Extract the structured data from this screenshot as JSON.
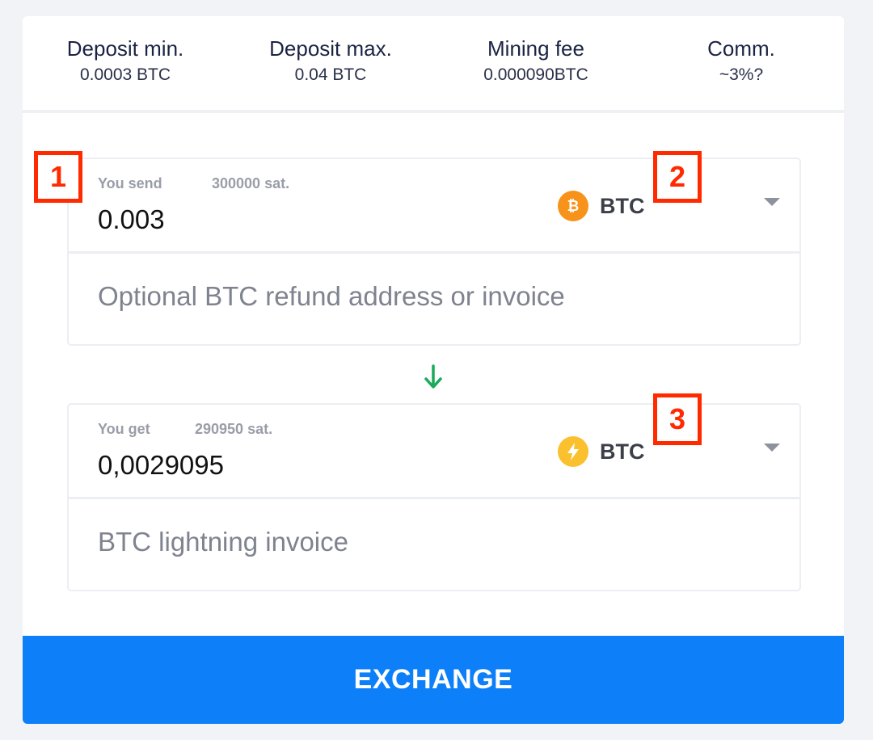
{
  "limits": [
    {
      "title": "Deposit min.",
      "value": "0.0003 BTC"
    },
    {
      "title": "Deposit max.",
      "value": "0.04 BTC"
    },
    {
      "title": "Mining fee",
      "value": "0.000090BTC"
    },
    {
      "title": "Comm.",
      "value": "~3%?"
    }
  ],
  "send": {
    "label": "You send",
    "sats": "300000 sat.",
    "amount": "0.003",
    "currency": "BTC",
    "icon": "bitcoin-icon",
    "refund_placeholder": "Optional BTC refund address or invoice"
  },
  "get": {
    "label": "You get",
    "sats": "290950 sat.",
    "amount": "0,0029095",
    "currency": "BTC",
    "icon": "lightning-icon",
    "invoice_placeholder": "BTC lightning invoice"
  },
  "markers": [
    "1",
    "2",
    "3"
  ],
  "exchange_label": "EXCHANGE",
  "colors": {
    "bitcoin": "#f7931a",
    "lightning": "#fbc02d",
    "arrow": "#1aaa5a",
    "button": "#0d7ff9",
    "marker": "#ff2a00"
  }
}
